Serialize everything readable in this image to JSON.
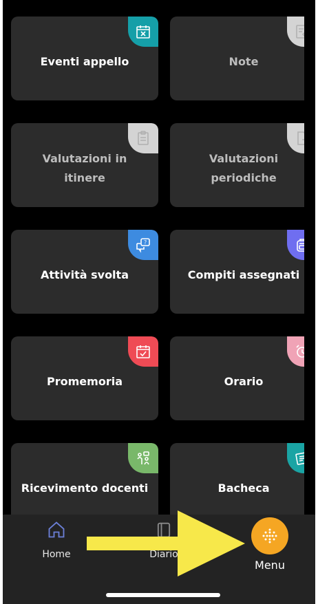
{
  "tiles": [
    {
      "label": "Eventi appello",
      "state": "active",
      "icon": "calendar-x-icon",
      "color": "#159fa8"
    },
    {
      "label": "Note",
      "state": "disabled",
      "icon": "notes-edit-icon",
      "color": "#d4d4d4"
    },
    {
      "label": "Valutazioni in itinere",
      "state": "disabled",
      "icon": "clipboard-doc-icon",
      "color": "#d4d4d4"
    },
    {
      "label": "Valutazioni periodiche",
      "state": "disabled",
      "icon": "doc-export-icon",
      "color": "#d4d4d4"
    },
    {
      "label": "Attività svolta",
      "state": "active",
      "icon": "question-chat-icon",
      "color": "#3d8be0"
    },
    {
      "label": "Compiti assegnati",
      "state": "active",
      "icon": "backpack-icon",
      "color": "#6f6ef0"
    },
    {
      "label": "Promemoria",
      "state": "active",
      "icon": "calendar-check-icon",
      "color": "#ef4b55"
    },
    {
      "label": "Orario",
      "state": "active",
      "icon": "alarm-clock-icon",
      "color": "#f0a3b6"
    },
    {
      "label": "Ricevimento docenti",
      "state": "active",
      "icon": "people-meeting-icon",
      "color": "#79b86a"
    },
    {
      "label": "Bacheca",
      "state": "active",
      "icon": "board-notes-icon",
      "color": "#1aa4a4"
    }
  ],
  "nav": {
    "home_label": "Home",
    "diario_label": "Diario",
    "menu_label": "Menu",
    "menu_color": "#f5a623"
  },
  "annotation": {
    "arrow_color": "#f7e84a",
    "arrow_target": "menu-button"
  }
}
